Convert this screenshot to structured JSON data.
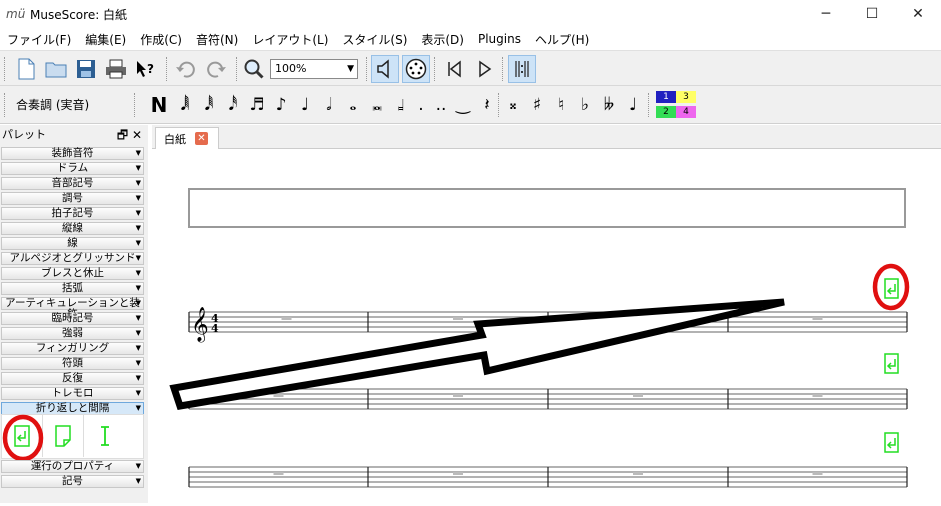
{
  "window": {
    "title": "MuseScore: 白紙",
    "app_icon": "mü",
    "controls": [
      "minimize-icon",
      "maximize-icon",
      "close-icon"
    ]
  },
  "menu": [
    "ファイル(F)",
    "編集(E)",
    "作成(C)",
    "音符(N)",
    "レイアウト(L)",
    "スタイル(S)",
    "表示(D)",
    "Plugins",
    "ヘルプ(H)"
  ],
  "toolbar": {
    "zoom_value": "100%",
    "concert_pitch": "合奏調 (実音)",
    "voices": [
      "1",
      "3",
      "2",
      "4"
    ],
    "voice_colors": [
      "#2020c0",
      "#ffff66",
      "#33dd55",
      "#ee66ee"
    ]
  },
  "palette": {
    "title": "パレット",
    "items": [
      "装飾音符",
      "ドラム",
      "音部記号",
      "調号",
      "拍子記号",
      "縦線",
      "線",
      "アルペジオとグリッサンド",
      "ブレスと休止",
      "括弧",
      "アーティキュレーションと装飾",
      "臨時記号",
      "強弱",
      "フィンガリング",
      "符頭",
      "反復",
      "トレモロ",
      "折り返しと間隔"
    ],
    "items_after": [
      "運行のプロパティ",
      "記号"
    ],
    "cells": [
      "line-break-icon",
      "page-break-icon",
      "spacer-icon"
    ]
  },
  "tab": {
    "label": "白紙"
  },
  "score": {
    "time_signature_top": "4",
    "time_signature_bottom": "4",
    "rest_symbol": "−"
  },
  "colors": {
    "break_green": "#22dd22",
    "highlight_red": "#e01010"
  }
}
